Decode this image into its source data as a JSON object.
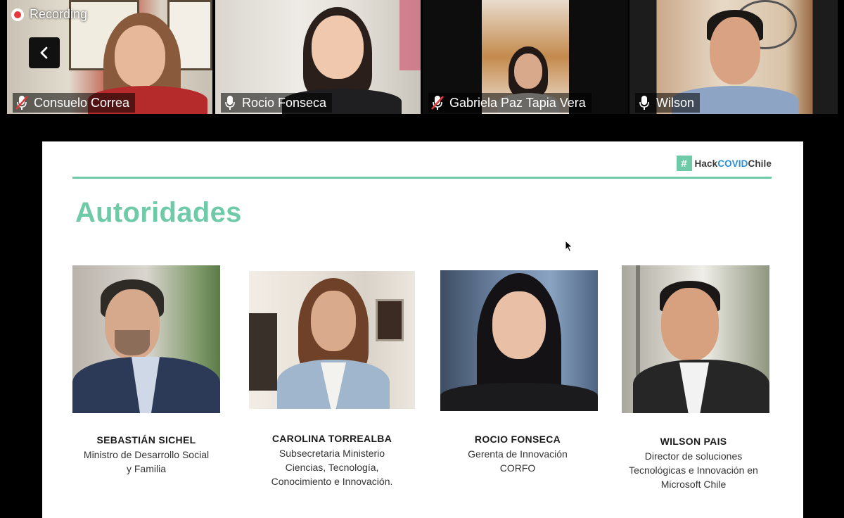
{
  "recording": {
    "label": "Recording"
  },
  "participants": [
    {
      "name": "Consuelo Correa",
      "muted": true
    },
    {
      "name": "Rocio Fonseca",
      "muted": false
    },
    {
      "name": "Gabriela Paz Tapia Vera",
      "muted": true
    },
    {
      "name": "Wilson",
      "muted": false,
      "active_speaker": true
    }
  ],
  "slide": {
    "brand": {
      "hash": "#",
      "hack": "Hack",
      "covid": "COVID",
      "chile": "Chile"
    },
    "title": "Autoridades",
    "cards": [
      {
        "name": "SEBASTIÁN SICHEL",
        "role": "Ministro de Desarrollo Social\ny Familia"
      },
      {
        "name": "CAROLINA TORREALBA",
        "role": "Subsecretaria Ministerio\nCiencias, Tecnología,\nConocimiento e Innovación."
      },
      {
        "name": "ROCIO FONSECA",
        "role": "Gerenta de Innovación\nCORFO"
      },
      {
        "name": "WILSON PAIS",
        "role": "Director de soluciones\nTecnológicas e Innovación en\nMicrosoft Chile"
      }
    ]
  },
  "colors": {
    "accent": "#6fcaa7",
    "active_speaker_border": "#d8e35a",
    "recording": "#e5383b",
    "brand_covid": "#2c8fd6"
  },
  "icons": [
    "record-icon",
    "back-arrow-icon",
    "mic-muted-icon",
    "mic-icon",
    "mouse-pointer-icon"
  ]
}
